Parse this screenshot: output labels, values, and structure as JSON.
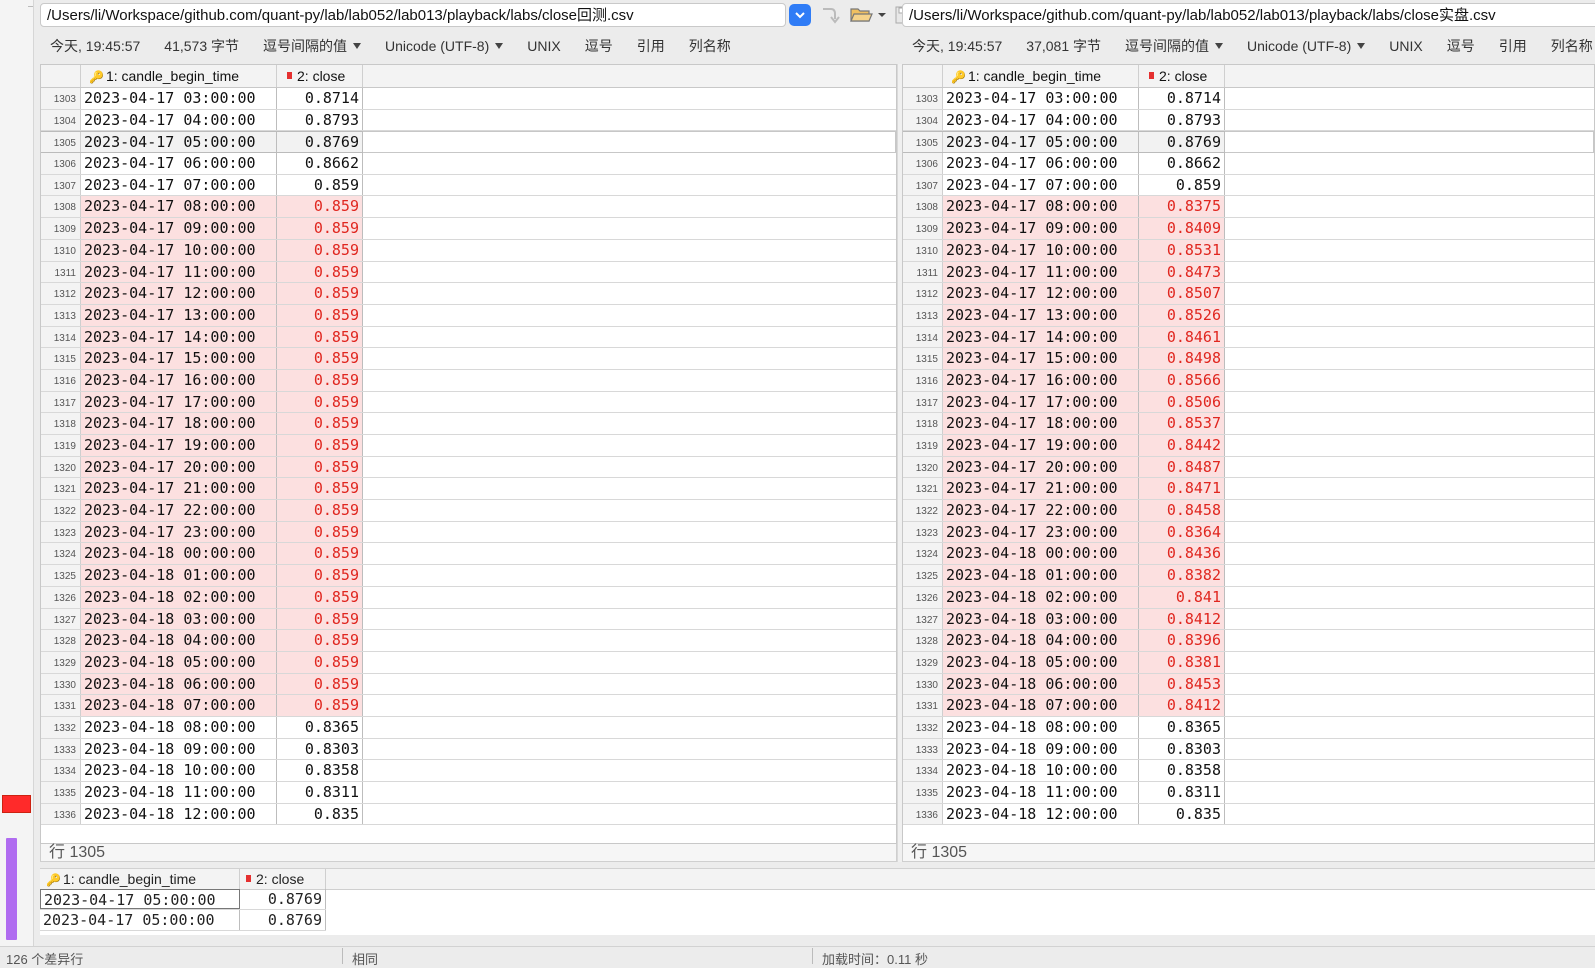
{
  "left": {
    "path": "/Users/li/Workspace/github.com/quant-py/lab/lab052/lab013/playback/labs/close回测.csv",
    "info": {
      "time": "今天, 19:45:57",
      "size": "41,573 字节",
      "delimiter": "逗号间隔的值",
      "encoding": "Unicode (UTF-8)",
      "lineend": "UNIX",
      "separator": "逗号",
      "quote": "引用",
      "colnames": "列名称"
    },
    "columns": [
      "1: candle_begin_time",
      "2: close"
    ],
    "rows": [
      {
        "n": "1303",
        "time": "2023-04-17 03:00:00",
        "close": "0.8714",
        "diff": false
      },
      {
        "n": "1304",
        "time": "2023-04-17 04:00:00",
        "close": "0.8793",
        "diff": false
      },
      {
        "n": "1305",
        "time": "2023-04-17 05:00:00",
        "close": "0.8769",
        "diff": false,
        "current": true
      },
      {
        "n": "1306",
        "time": "2023-04-17 06:00:00",
        "close": "0.8662",
        "diff": false
      },
      {
        "n": "1307",
        "time": "2023-04-17 07:00:00",
        "close": "0.859",
        "diff": false
      },
      {
        "n": "1308",
        "time": "2023-04-17 08:00:00",
        "close": "0.859",
        "diff": true
      },
      {
        "n": "1309",
        "time": "2023-04-17 09:00:00",
        "close": "0.859",
        "diff": true
      },
      {
        "n": "1310",
        "time": "2023-04-17 10:00:00",
        "close": "0.859",
        "diff": true
      },
      {
        "n": "1311",
        "time": "2023-04-17 11:00:00",
        "close": "0.859",
        "diff": true
      },
      {
        "n": "1312",
        "time": "2023-04-17 12:00:00",
        "close": "0.859",
        "diff": true
      },
      {
        "n": "1313",
        "time": "2023-04-17 13:00:00",
        "close": "0.859",
        "diff": true
      },
      {
        "n": "1314",
        "time": "2023-04-17 14:00:00",
        "close": "0.859",
        "diff": true
      },
      {
        "n": "1315",
        "time": "2023-04-17 15:00:00",
        "close": "0.859",
        "diff": true
      },
      {
        "n": "1316",
        "time": "2023-04-17 16:00:00",
        "close": "0.859",
        "diff": true
      },
      {
        "n": "1317",
        "time": "2023-04-17 17:00:00",
        "close": "0.859",
        "diff": true
      },
      {
        "n": "1318",
        "time": "2023-04-17 18:00:00",
        "close": "0.859",
        "diff": true
      },
      {
        "n": "1319",
        "time": "2023-04-17 19:00:00",
        "close": "0.859",
        "diff": true
      },
      {
        "n": "1320",
        "time": "2023-04-17 20:00:00",
        "close": "0.859",
        "diff": true
      },
      {
        "n": "1321",
        "time": "2023-04-17 21:00:00",
        "close": "0.859",
        "diff": true
      },
      {
        "n": "1322",
        "time": "2023-04-17 22:00:00",
        "close": "0.859",
        "diff": true
      },
      {
        "n": "1323",
        "time": "2023-04-17 23:00:00",
        "close": "0.859",
        "diff": true
      },
      {
        "n": "1324",
        "time": "2023-04-18 00:00:00",
        "close": "0.859",
        "diff": true
      },
      {
        "n": "1325",
        "time": "2023-04-18 01:00:00",
        "close": "0.859",
        "diff": true
      },
      {
        "n": "1326",
        "time": "2023-04-18 02:00:00",
        "close": "0.859",
        "diff": true
      },
      {
        "n": "1327",
        "time": "2023-04-18 03:00:00",
        "close": "0.859",
        "diff": true
      },
      {
        "n": "1328",
        "time": "2023-04-18 04:00:00",
        "close": "0.859",
        "diff": true
      },
      {
        "n": "1329",
        "time": "2023-04-18 05:00:00",
        "close": "0.859",
        "diff": true
      },
      {
        "n": "1330",
        "time": "2023-04-18 06:00:00",
        "close": "0.859",
        "diff": true
      },
      {
        "n": "1331",
        "time": "2023-04-18 07:00:00",
        "close": "0.859",
        "diff": true
      },
      {
        "n": "1332",
        "time": "2023-04-18 08:00:00",
        "close": "0.8365",
        "diff": false
      },
      {
        "n": "1333",
        "time": "2023-04-18 09:00:00",
        "close": "0.8303",
        "diff": false
      },
      {
        "n": "1334",
        "time": "2023-04-18 10:00:00",
        "close": "0.8358",
        "diff": false
      },
      {
        "n": "1335",
        "time": "2023-04-18 11:00:00",
        "close": "0.8311",
        "diff": false
      },
      {
        "n": "1336",
        "time": "2023-04-18 12:00:00",
        "close": "0.835",
        "diff": false
      }
    ],
    "status": "行 1305"
  },
  "right": {
    "path": "/Users/li/Workspace/github.com/quant-py/lab/lab052/lab013/playback/labs/close实盘.csv",
    "info": {
      "time": "今天, 19:45:57",
      "size": "37,081 字节",
      "delimiter": "逗号间隔的值",
      "encoding": "Unicode (UTF-8)",
      "lineend": "UNIX",
      "separator": "逗号",
      "quote": "引用",
      "colnames": "列名称"
    },
    "columns": [
      "1: candle_begin_time",
      "2: close"
    ],
    "rows": [
      {
        "n": "1303",
        "time": "2023-04-17 03:00:00",
        "close": "0.8714",
        "diff": false
      },
      {
        "n": "1304",
        "time": "2023-04-17 04:00:00",
        "close": "0.8793",
        "diff": false
      },
      {
        "n": "1305",
        "time": "2023-04-17 05:00:00",
        "close": "0.8769",
        "diff": false,
        "current": true
      },
      {
        "n": "1306",
        "time": "2023-04-17 06:00:00",
        "close": "0.8662",
        "diff": false
      },
      {
        "n": "1307",
        "time": "2023-04-17 07:00:00",
        "close": "0.859",
        "diff": false
      },
      {
        "n": "1308",
        "time": "2023-04-17 08:00:00",
        "close": "0.8375",
        "diff": true
      },
      {
        "n": "1309",
        "time": "2023-04-17 09:00:00",
        "close": "0.8409",
        "diff": true
      },
      {
        "n": "1310",
        "time": "2023-04-17 10:00:00",
        "close": "0.8531",
        "diff": true
      },
      {
        "n": "1311",
        "time": "2023-04-17 11:00:00",
        "close": "0.8473",
        "diff": true
      },
      {
        "n": "1312",
        "time": "2023-04-17 12:00:00",
        "close": "0.8507",
        "diff": true
      },
      {
        "n": "1313",
        "time": "2023-04-17 13:00:00",
        "close": "0.8526",
        "diff": true
      },
      {
        "n": "1314",
        "time": "2023-04-17 14:00:00",
        "close": "0.8461",
        "diff": true
      },
      {
        "n": "1315",
        "time": "2023-04-17 15:00:00",
        "close": "0.8498",
        "diff": true
      },
      {
        "n": "1316",
        "time": "2023-04-17 16:00:00",
        "close": "0.8566",
        "diff": true
      },
      {
        "n": "1317",
        "time": "2023-04-17 17:00:00",
        "close": "0.8506",
        "diff": true
      },
      {
        "n": "1318",
        "time": "2023-04-17 18:00:00",
        "close": "0.8537",
        "diff": true
      },
      {
        "n": "1319",
        "time": "2023-04-17 19:00:00",
        "close": "0.8442",
        "diff": true
      },
      {
        "n": "1320",
        "time": "2023-04-17 20:00:00",
        "close": "0.8487",
        "diff": true
      },
      {
        "n": "1321",
        "time": "2023-04-17 21:00:00",
        "close": "0.8471",
        "diff": true
      },
      {
        "n": "1322",
        "time": "2023-04-17 22:00:00",
        "close": "0.8458",
        "diff": true
      },
      {
        "n": "1323",
        "time": "2023-04-17 23:00:00",
        "close": "0.8364",
        "diff": true
      },
      {
        "n": "1324",
        "time": "2023-04-18 00:00:00",
        "close": "0.8436",
        "diff": true
      },
      {
        "n": "1325",
        "time": "2023-04-18 01:00:00",
        "close": "0.8382",
        "diff": true
      },
      {
        "n": "1326",
        "time": "2023-04-18 02:00:00",
        "close": "0.841",
        "diff": true
      },
      {
        "n": "1327",
        "time": "2023-04-18 03:00:00",
        "close": "0.8412",
        "diff": true
      },
      {
        "n": "1328",
        "time": "2023-04-18 04:00:00",
        "close": "0.8396",
        "diff": true
      },
      {
        "n": "1329",
        "time": "2023-04-18 05:00:00",
        "close": "0.8381",
        "diff": true
      },
      {
        "n": "1330",
        "time": "2023-04-18 06:00:00",
        "close": "0.8453",
        "diff": true
      },
      {
        "n": "1331",
        "time": "2023-04-18 07:00:00",
        "close": "0.8412",
        "diff": true
      },
      {
        "n": "1332",
        "time": "2023-04-18 08:00:00",
        "close": "0.8365",
        "diff": false
      },
      {
        "n": "1333",
        "time": "2023-04-18 09:00:00",
        "close": "0.8303",
        "diff": false
      },
      {
        "n": "1334",
        "time": "2023-04-18 10:00:00",
        "close": "0.8358",
        "diff": false
      },
      {
        "n": "1335",
        "time": "2023-04-18 11:00:00",
        "close": "0.8311",
        "diff": false
      },
      {
        "n": "1336",
        "time": "2023-04-18 12:00:00",
        "close": "0.835",
        "diff": false
      }
    ],
    "status": "行 1305"
  },
  "compare": {
    "columns": [
      "1: candle_begin_time",
      "2: close"
    ],
    "rows": [
      {
        "time": "2023-04-17 05:00:00",
        "close": "0.8769"
      },
      {
        "time": "2023-04-17 05:00:00",
        "close": "0.8769"
      }
    ]
  },
  "footer": {
    "left": "126 个差异行",
    "mid": "相同",
    "right": "加载时间：0.11 秒"
  },
  "colors": {
    "accent": "#2f7cf6",
    "diff_bg": "#fce0e0",
    "diff_text": "#e0261f",
    "marker": "#ff2a2a",
    "purple": "#b06cf0"
  }
}
